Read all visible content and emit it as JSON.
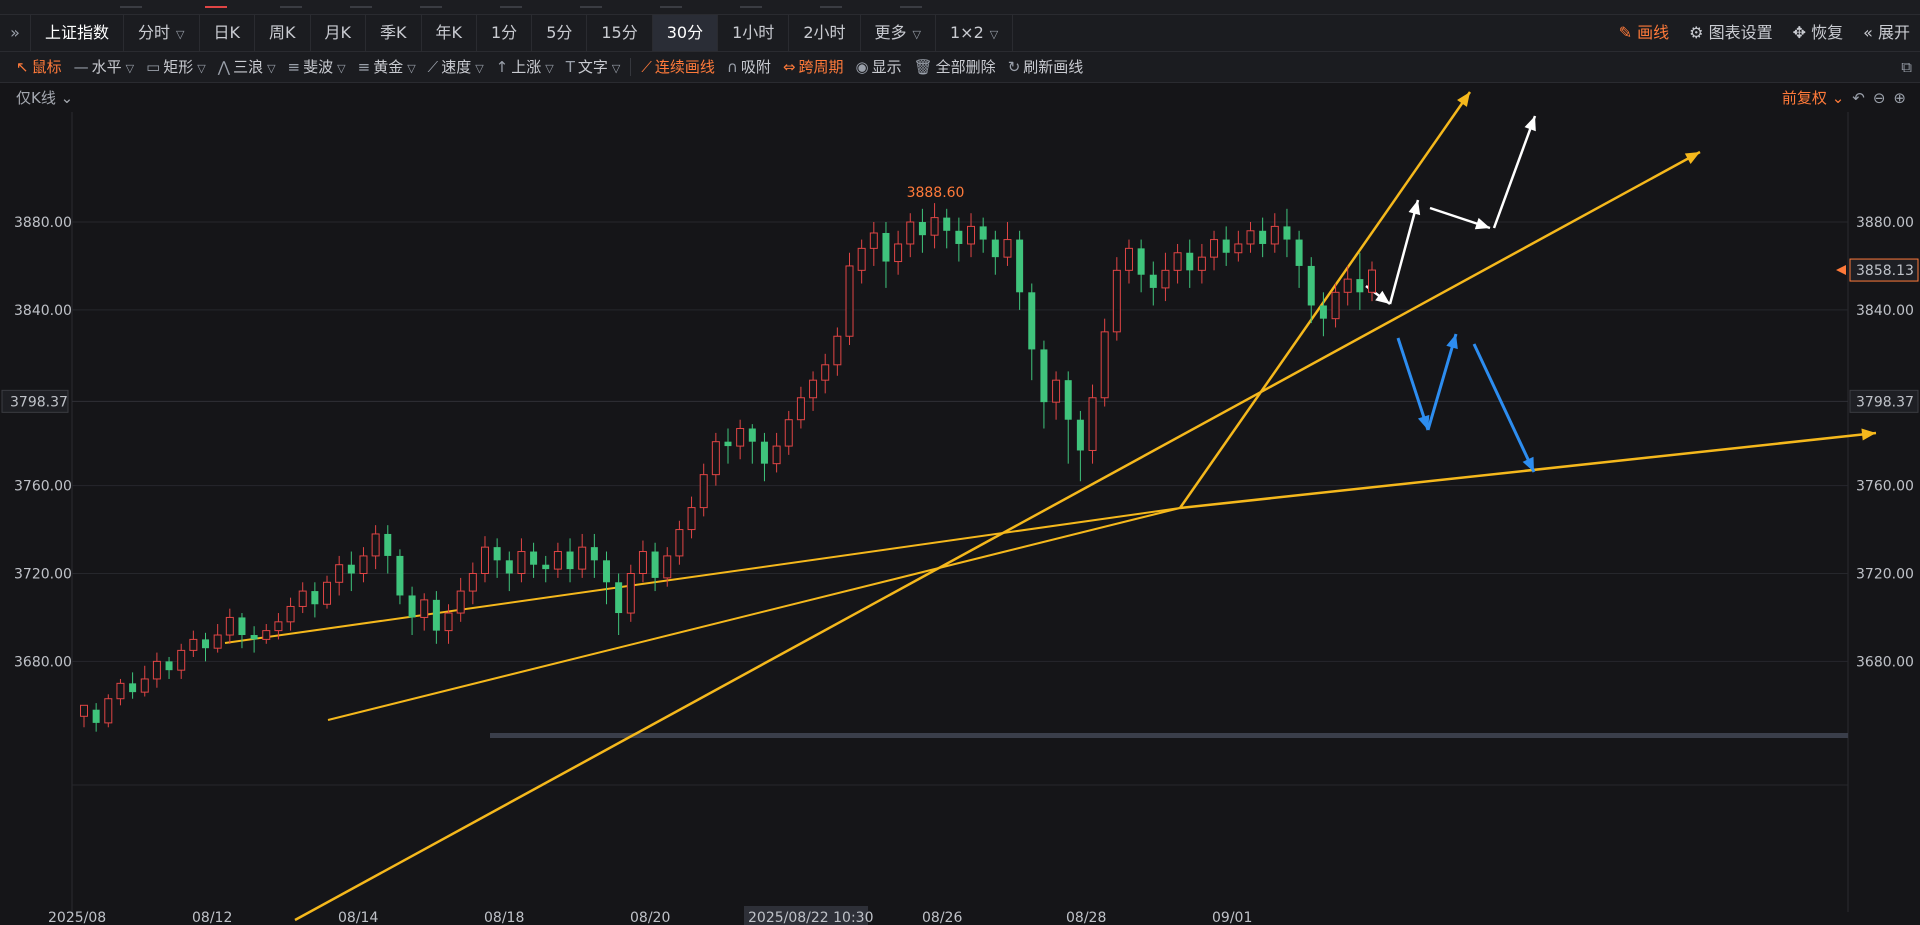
{
  "period_bar": {
    "symbol": "上证指数",
    "items": [
      {
        "label": "分时",
        "dropdown": true
      },
      {
        "label": "日K"
      },
      {
        "label": "周K"
      },
      {
        "label": "月K"
      },
      {
        "label": "季K"
      },
      {
        "label": "年K"
      },
      {
        "label": "1分"
      },
      {
        "label": "5分"
      },
      {
        "label": "15分"
      },
      {
        "label": "30分",
        "active": true
      },
      {
        "label": "1小时"
      },
      {
        "label": "2小时"
      },
      {
        "label": "更多",
        "dropdown": true
      },
      {
        "label": "1×2",
        "dropdown": true
      }
    ],
    "right": {
      "draw": "画线",
      "settings": "图表设置",
      "restore": "恢复",
      "expand": "展开"
    }
  },
  "draw_tools": [
    {
      "icon": "cursor-icon",
      "glyph": "↖",
      "label": "鼠标",
      "orange": true
    },
    {
      "icon": "horizontal-line-icon",
      "glyph": "—",
      "label": "水平"
    },
    {
      "icon": "rectangle-icon",
      "glyph": "▭",
      "label": "矩形"
    },
    {
      "icon": "three-wave-icon",
      "glyph": "⋀",
      "label": "三浪"
    },
    {
      "icon": "fibonacci-icon",
      "glyph": "≡",
      "label": "斐波"
    },
    {
      "icon": "gold-icon",
      "glyph": "≡",
      "label": "黄金"
    },
    {
      "icon": "speed-icon",
      "glyph": "⟋",
      "label": "速度"
    },
    {
      "icon": "up-arrow-icon",
      "glyph": "↑",
      "label": "上涨"
    },
    {
      "icon": "text-icon",
      "glyph": "T",
      "label": "文字"
    }
  ],
  "draw_actions": [
    {
      "icon": "continuous-line-icon",
      "glyph": "⟋",
      "label": "连续画线",
      "orange": true
    },
    {
      "icon": "magnet-icon",
      "glyph": "∩",
      "label": "吸附"
    },
    {
      "icon": "cross-period-icon",
      "glyph": "⇔",
      "label": "跨周期",
      "orange": true
    },
    {
      "icon": "eye-icon",
      "glyph": "◉",
      "label": "显示"
    },
    {
      "icon": "trash-icon",
      "glyph": "🗑",
      "label": "全部删除"
    },
    {
      "icon": "refresh-icon",
      "glyph": "↻",
      "label": "刷新画线"
    }
  ],
  "subbar": {
    "kline_toggle": "仅K线",
    "adjust": "前复权"
  },
  "y_axis_labels": [
    "3880.00",
    "3840.00",
    "3760.00",
    "3720.00",
    "3680.00"
  ],
  "y_axis_values": [
    3880,
    3840,
    3760,
    3720,
    3680
  ],
  "crosshair_price": "3798.37",
  "crosshair_value": 3798.37,
  "last_price": "3858.13",
  "last_value": 3858.13,
  "high_label": "3888.60",
  "x_axis_labels": [
    "2025/08",
    "08/12",
    "08/14",
    "08/18",
    "08/20",
    "2025/08/22 10:30",
    "08/26",
    "08/28",
    "09/01"
  ],
  "colors": {
    "up": "#e04545",
    "down": "#3fc47c",
    "trend": "#f5b81c",
    "accent": "#ff7a3a",
    "blue_arrow": "#2d8df0",
    "white_arrow": "#ffffff"
  },
  "chart_data": {
    "type": "candlestick",
    "symbol": "上证指数",
    "period": "30分",
    "y_range": [
      3650,
      3910
    ],
    "high": 3888.6,
    "last": 3858.13,
    "candles": [
      [
        3655,
        3660,
        3650,
        3658
      ],
      [
        3658,
        3652,
        3648,
        3661
      ],
      [
        3652,
        3663,
        3650,
        3665
      ],
      [
        3663,
        3670,
        3660,
        3672
      ],
      [
        3670,
        3666,
        3663,
        3675
      ],
      [
        3666,
        3672,
        3664,
        3678
      ],
      [
        3672,
        3680,
        3668,
        3684
      ],
      [
        3680,
        3676,
        3672,
        3682
      ],
      [
        3676,
        3685,
        3672,
        3688
      ],
      [
        3685,
        3690,
        3682,
        3694
      ],
      [
        3690,
        3686,
        3680,
        3693
      ],
      [
        3686,
        3692,
        3684,
        3697
      ],
      [
        3692,
        3700,
        3688,
        3704
      ],
      [
        3700,
        3692,
        3686,
        3702
      ],
      [
        3692,
        3690,
        3684,
        3696
      ],
      [
        3690,
        3694,
        3688,
        3697
      ],
      [
        3694,
        3698,
        3690,
        3702
      ],
      [
        3698,
        3705,
        3694,
        3709
      ],
      [
        3705,
        3712,
        3702,
        3716
      ],
      [
        3712,
        3706,
        3700,
        3716
      ],
      [
        3706,
        3716,
        3704,
        3719
      ],
      [
        3716,
        3724,
        3710,
        3728
      ],
      [
        3724,
        3720,
        3712,
        3730
      ],
      [
        3720,
        3728,
        3716,
        3732
      ],
      [
        3728,
        3738,
        3722,
        3742
      ],
      [
        3738,
        3728,
        3720,
        3742
      ],
      [
        3728,
        3710,
        3706,
        3731
      ],
      [
        3710,
        3700,
        3692,
        3714
      ],
      [
        3700,
        3708,
        3694,
        3711
      ],
      [
        3708,
        3694,
        3688,
        3712
      ],
      [
        3694,
        3702,
        3688,
        3706
      ],
      [
        3702,
        3712,
        3698,
        3718
      ],
      [
        3712,
        3720,
        3706,
        3725
      ],
      [
        3720,
        3732,
        3716,
        3737
      ],
      [
        3732,
        3726,
        3718,
        3736
      ],
      [
        3726,
        3720,
        3712,
        3730
      ],
      [
        3720,
        3730,
        3716,
        3736
      ],
      [
        3730,
        3724,
        3718,
        3734
      ],
      [
        3724,
        3722,
        3716,
        3728
      ],
      [
        3722,
        3730,
        3718,
        3734
      ],
      [
        3730,
        3722,
        3716,
        3736
      ],
      [
        3722,
        3732,
        3718,
        3738
      ],
      [
        3732,
        3726,
        3718,
        3738
      ],
      [
        3726,
        3716,
        3706,
        3730
      ],
      [
        3716,
        3702,
        3692,
        3720
      ],
      [
        3702,
        3720,
        3698,
        3724
      ],
      [
        3720,
        3730,
        3716,
        3735
      ],
      [
        3730,
        3718,
        3712,
        3734
      ],
      [
        3718,
        3728,
        3714,
        3732
      ],
      [
        3728,
        3740,
        3724,
        3744
      ],
      [
        3740,
        3750,
        3736,
        3755
      ],
      [
        3750,
        3765,
        3746,
        3770
      ],
      [
        3765,
        3780,
        3760,
        3784
      ],
      [
        3780,
        3778,
        3770,
        3786
      ],
      [
        3778,
        3786,
        3772,
        3790
      ],
      [
        3786,
        3780,
        3770,
        3788
      ],
      [
        3780,
        3770,
        3762,
        3784
      ],
      [
        3770,
        3778,
        3766,
        3784
      ],
      [
        3778,
        3790,
        3774,
        3794
      ],
      [
        3790,
        3800,
        3786,
        3805
      ],
      [
        3800,
        3808,
        3794,
        3812
      ],
      [
        3808,
        3815,
        3802,
        3820
      ],
      [
        3815,
        3828,
        3810,
        3832
      ],
      [
        3828,
        3860,
        3824,
        3866
      ],
      [
        3858,
        3868,
        3852,
        3872
      ],
      [
        3868,
        3875,
        3860,
        3880
      ],
      [
        3875,
        3862,
        3850,
        3880
      ],
      [
        3862,
        3870,
        3856,
        3876
      ],
      [
        3870,
        3880,
        3864,
        3884
      ],
      [
        3880,
        3874,
        3866,
        3886
      ],
      [
        3874,
        3882,
        3868,
        3888.6
      ],
      [
        3882,
        3876,
        3868,
        3886
      ],
      [
        3876,
        3870,
        3862,
        3882
      ],
      [
        3870,
        3878,
        3864,
        3884
      ],
      [
        3878,
        3872,
        3866,
        3882
      ],
      [
        3872,
        3864,
        3856,
        3876
      ],
      [
        3864,
        3872,
        3860,
        3880
      ],
      [
        3872,
        3848,
        3840,
        3876
      ],
      [
        3848,
        3822,
        3808,
        3852
      ],
      [
        3822,
        3798,
        3786,
        3826
      ],
      [
        3798,
        3808,
        3790,
        3812
      ],
      [
        3808,
        3790,
        3770,
        3812
      ],
      [
        3790,
        3776,
        3762,
        3794
      ],
      [
        3776,
        3800,
        3770,
        3806
      ],
      [
        3800,
        3830,
        3796,
        3836
      ],
      [
        3830,
        3858,
        3826,
        3864
      ],
      [
        3858,
        3868,
        3852,
        3872
      ],
      [
        3868,
        3856,
        3848,
        3872
      ],
      [
        3856,
        3850,
        3842,
        3862
      ],
      [
        3850,
        3858,
        3844,
        3866
      ],
      [
        3858,
        3866,
        3852,
        3870
      ],
      [
        3866,
        3858,
        3850,
        3872
      ],
      [
        3858,
        3864,
        3852,
        3870
      ],
      [
        3864,
        3872,
        3858,
        3876
      ],
      [
        3872,
        3866,
        3860,
        3878
      ],
      [
        3866,
        3870,
        3862,
        3876
      ],
      [
        3870,
        3876,
        3866,
        3880
      ],
      [
        3876,
        3870,
        3864,
        3882
      ],
      [
        3870,
        3878,
        3866,
        3884
      ],
      [
        3878,
        3872,
        3864,
        3886
      ],
      [
        3872,
        3860,
        3850,
        3876
      ],
      [
        3860,
        3842,
        3834,
        3864
      ],
      [
        3842,
        3836,
        3828,
        3848
      ],
      [
        3836,
        3848,
        3832,
        3852
      ],
      [
        3848,
        3854,
        3842,
        3860
      ],
      [
        3854,
        3848,
        3840,
        3866
      ],
      [
        3848,
        3858.13,
        3844,
        3862
      ]
    ]
  }
}
